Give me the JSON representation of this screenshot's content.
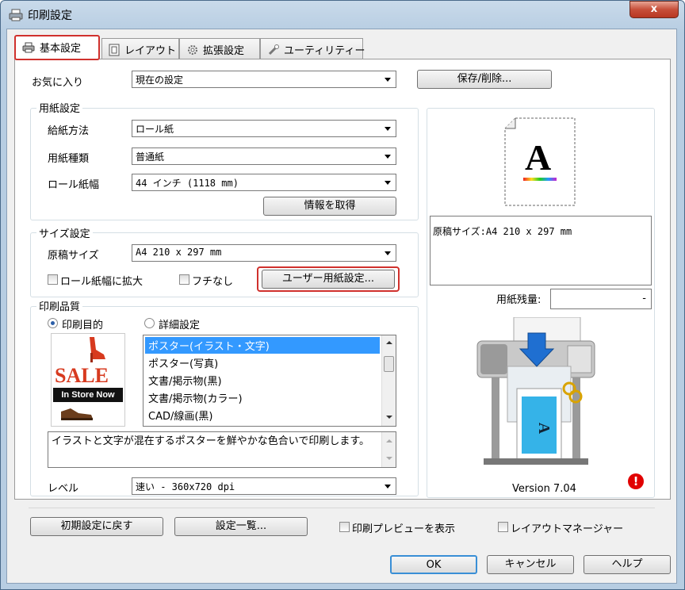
{
  "window": {
    "title": "印刷設定",
    "close_label": "x"
  },
  "tabs": [
    {
      "label": "基本設定"
    },
    {
      "label": "レイアウト"
    },
    {
      "label": "拡張設定"
    },
    {
      "label": "ユーティリティー"
    }
  ],
  "favorites": {
    "label": "お気に入り",
    "value": "現在の設定",
    "save_button": "保存/削除..."
  },
  "paper": {
    "group_label": "用紙設定",
    "source_label": "給紙方法",
    "source_value": "ロール紙",
    "type_label": "用紙種類",
    "type_value": "普通紙",
    "width_label": "ロール紙幅",
    "width_value": "44 インチ (1118 mm)",
    "info_button": "情報を取得"
  },
  "size": {
    "group_label": "サイズ設定",
    "doc_size_label": "原稿サイズ",
    "doc_size_value": "A4 210 x 297 mm",
    "fit_roll_label": "ロール紙幅に拡大",
    "borderless_label": "フチなし",
    "user_paper_button": "ユーザー用紙設定..."
  },
  "quality": {
    "group_label": "印刷品質",
    "purpose_label": "印刷目的",
    "detail_label": "詳細設定",
    "sale_text": "SALE",
    "instore_text": "In Store Now",
    "items": [
      "ポスター(イラスト・文字)",
      "ポスター(写真)",
      "文書/掲示物(黒)",
      "文書/掲示物(カラー)",
      "CAD/線画(黒)"
    ],
    "description": "イラストと文字が混在するポスターを鮮やかな色合いで印刷します。",
    "level_label": "レベル",
    "level_value": "速い - 360x720 dpi"
  },
  "preview": {
    "doc_size_text": "原稿サイズ:A4 210 x 297 mm",
    "remaining_label": "用紙残量:",
    "remaining_value": "-",
    "version": "Version 7.04",
    "sheet_letter": "A"
  },
  "footer": {
    "reset_button": "初期設定に戻す",
    "list_button": "設定一覧...",
    "preview_check": "印刷プレビューを表示",
    "layout_manager_check": "レイアウトマネージャー",
    "ok": "OK",
    "cancel": "キャンセル",
    "help": "ヘルプ"
  }
}
